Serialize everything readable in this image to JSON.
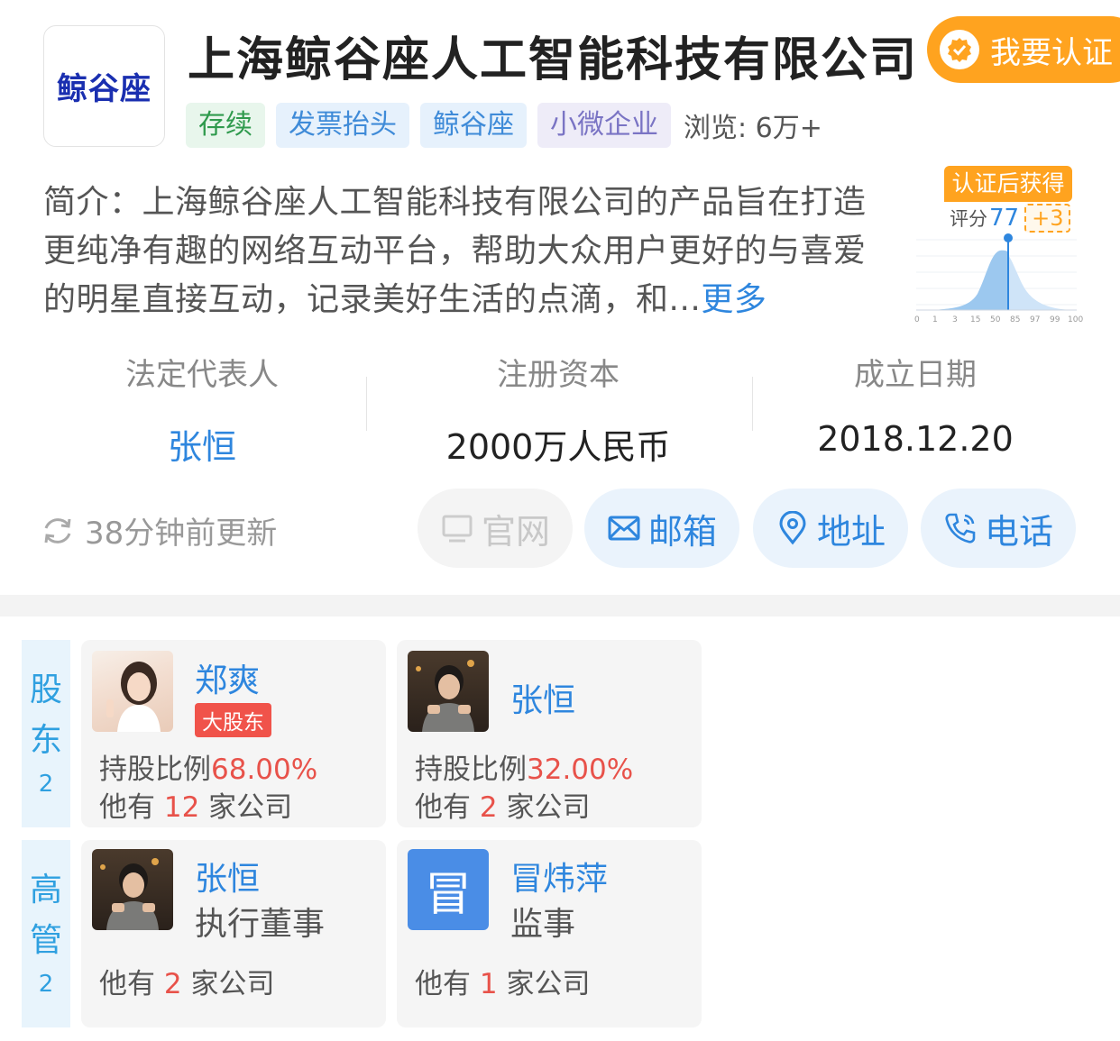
{
  "company": {
    "logo_text": "鲸谷座",
    "name": "上海鲸谷座人工智能科技有限公司",
    "certify_label": "我要认证",
    "tags": [
      "存续",
      "发票抬头",
      "鲸谷座",
      "小微企业"
    ],
    "views_label": "浏览: 6万+",
    "intro_text": "简介：上海鲸谷座人工智能科技有限公司的产品旨在打造更纯净有趣的网络互动平台，帮助大众用户更好的与喜爱的明星直接互动，记录美好生活的点滴，和...",
    "more_label": "更多"
  },
  "score": {
    "tag_label": "认证后获得",
    "label": "评分",
    "value": "77",
    "plus": "+3",
    "axis_ticks": [
      "0",
      "1",
      "3",
      "15",
      "50",
      "85",
      "97",
      "99",
      "100"
    ]
  },
  "stats": [
    {
      "label": "法定代表人",
      "value": "张恒"
    },
    {
      "label": "注册资本",
      "value": "2000万人民币"
    },
    {
      "label": "成立日期",
      "value": "2018.12.20"
    }
  ],
  "update_text": "38分钟前更新",
  "actions": {
    "website": "官网",
    "email": "邮箱",
    "address": "地址",
    "phone": "电话"
  },
  "shareholders": {
    "label_chars": [
      "股",
      "东"
    ],
    "count": "2",
    "items": [
      {
        "name": "郑爽",
        "badge": "大股东",
        "ratio_label": "持股比例",
        "ratio": "68.00%",
        "companies_prefix": "他有",
        "companies": "12",
        "companies_suffix": "家公司"
      },
      {
        "name": "张恒",
        "ratio_label": "持股比例",
        "ratio": "32.00%",
        "companies_prefix": "他有",
        "companies": "2",
        "companies_suffix": "家公司"
      }
    ]
  },
  "executives": {
    "label_chars": [
      "高",
      "管"
    ],
    "count": "2",
    "items": [
      {
        "name": "张恒",
        "role": "执行董事",
        "companies_prefix": "他有",
        "companies": "2",
        "companies_suffix": "家公司"
      },
      {
        "name": "冒炜萍",
        "avatar_char": "冒",
        "role": "监事",
        "companies_prefix": "他有",
        "companies": "1",
        "companies_suffix": "家公司"
      }
    ]
  }
}
